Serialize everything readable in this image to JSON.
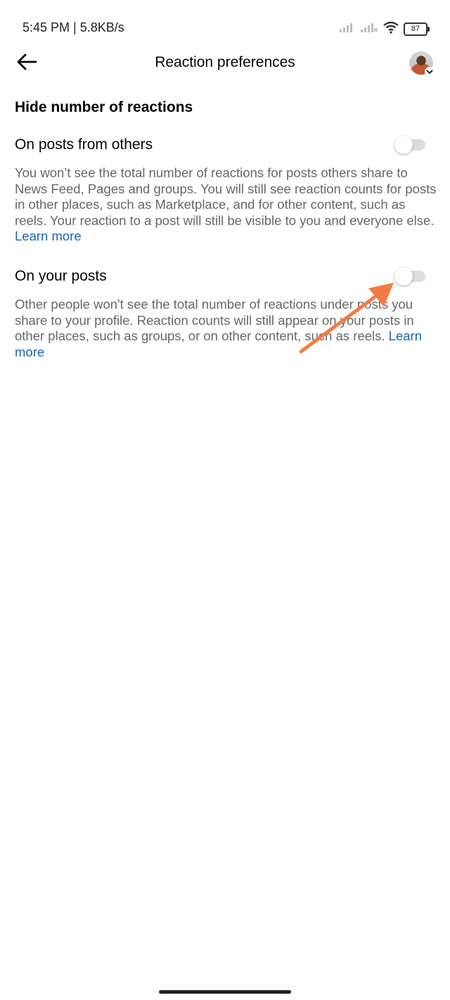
{
  "status_bar": {
    "time": "5:45 PM | 5.8KB/s",
    "battery": "87",
    "icons": [
      "signal-icon",
      "signal-icon",
      "wifi-icon",
      "battery-icon"
    ]
  },
  "header": {
    "title": "Reaction preferences",
    "back_icon": "arrow-left-icon",
    "avatar_icon": "chevron-down-icon"
  },
  "section": {
    "title": "Hide number of reactions"
  },
  "settings": [
    {
      "label": "On posts from others",
      "description": "You won’t see the total number of reactions for posts others share to News Feed, Pages and groups. You will still see reaction counts for posts in other places, such as Marketplace, and for other content, such as reels. Your reaction to a post will still be visible to you and everyone else.",
      "link": "Learn more",
      "enabled": false
    },
    {
      "label": "On your posts",
      "description": "Other people won't see the total number of reactions under posts you share to your profile. Reaction counts will still appear on your posts in other places, such as groups, or on other content, such as reels.",
      "link": "Learn more",
      "enabled": false
    }
  ],
  "colors": {
    "link": "#1d64b3",
    "description": "#65676b",
    "toggle_track": "#dadde1",
    "annotation_arrow": "#f47c43"
  }
}
